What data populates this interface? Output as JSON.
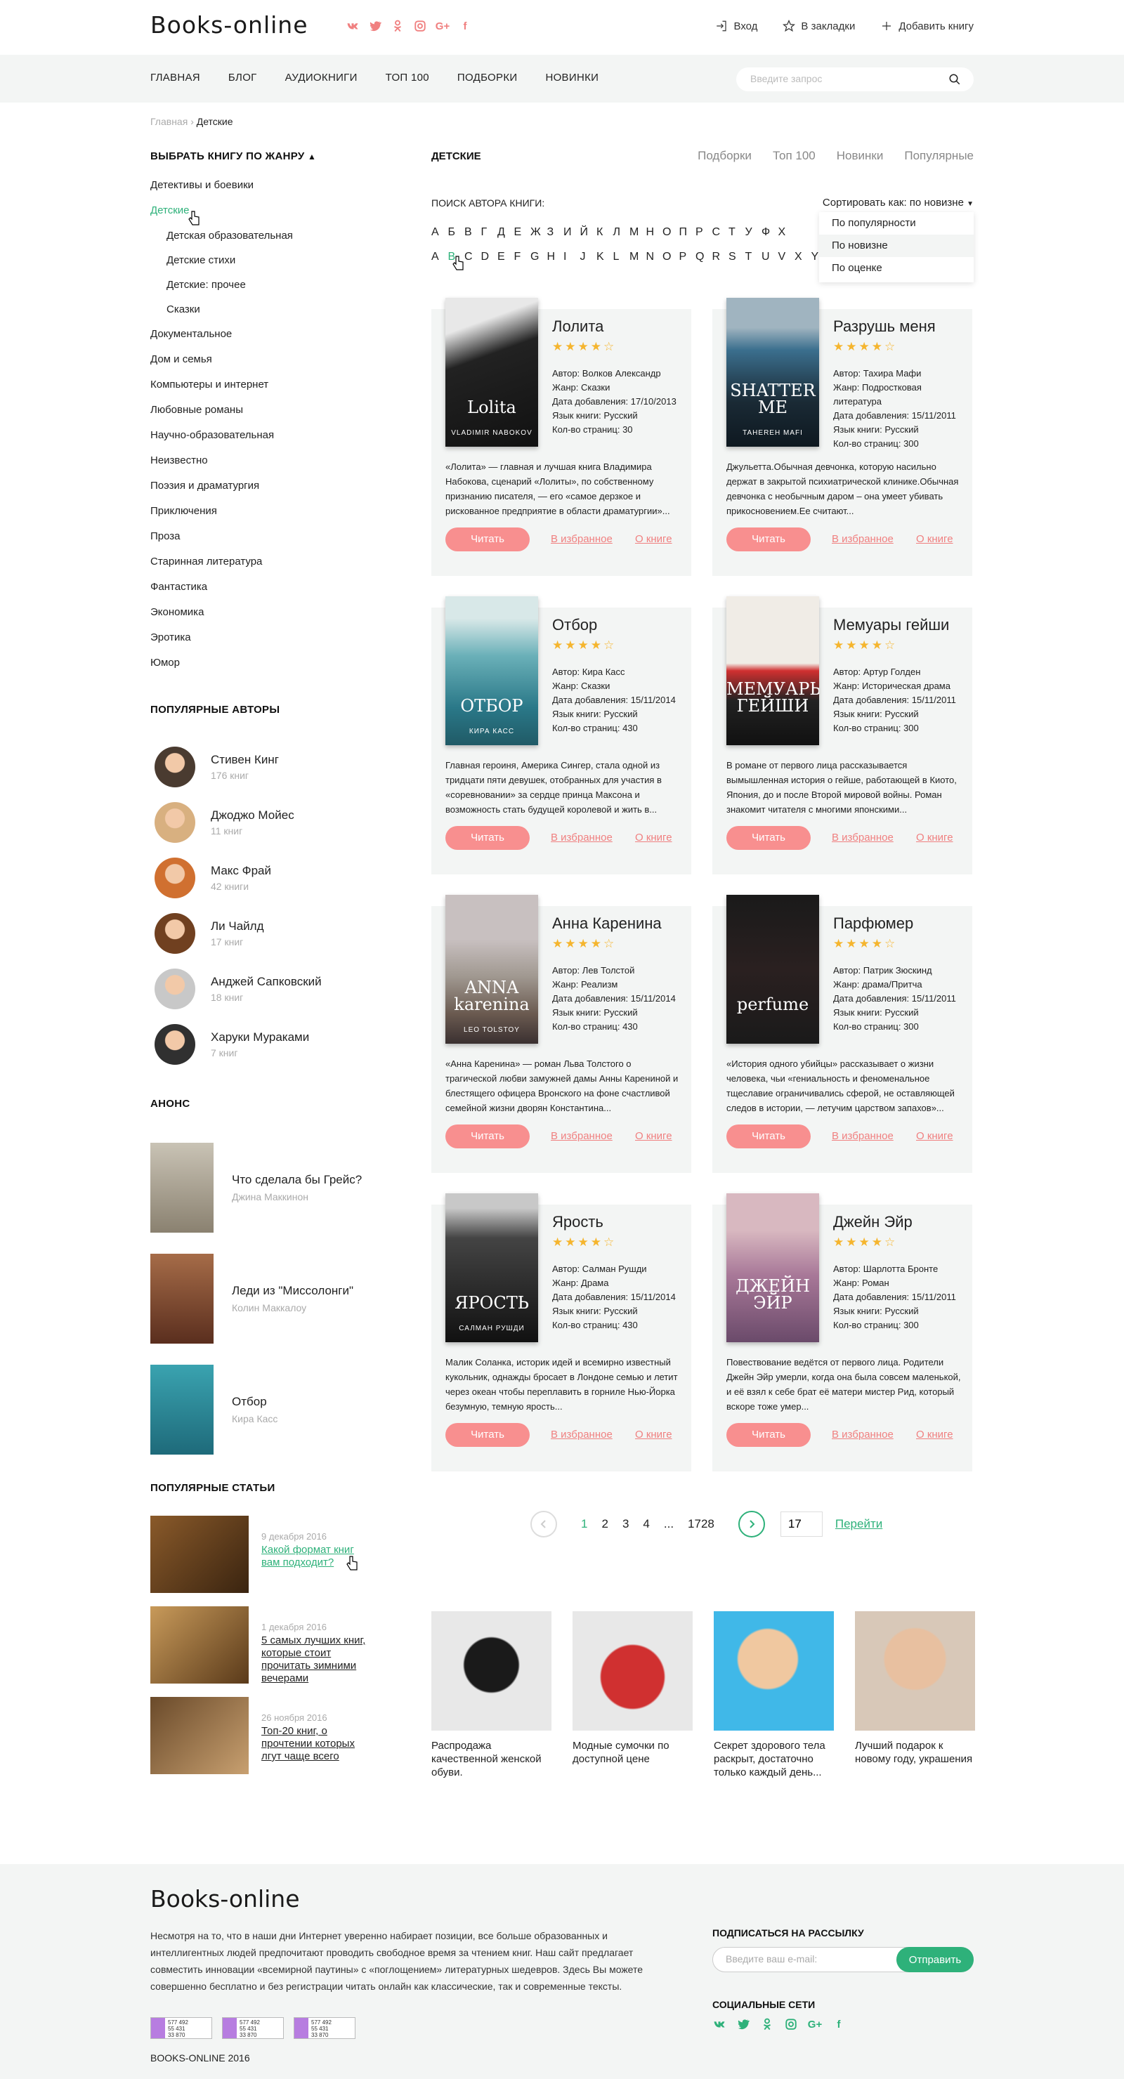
{
  "header": {
    "logo": "Books-online",
    "social_icons": [
      "vk-icon",
      "twitter-icon",
      "odnoklassniki-icon",
      "instagram-icon",
      "google-plus-icon",
      "facebook-icon"
    ],
    "login": "Вход",
    "bookmarks": "В закладки",
    "add_book": "Добавить книгу"
  },
  "nav": {
    "items": [
      "ГЛАВНАЯ",
      "БЛОГ",
      "АУДИОКНИГИ",
      "ТОП 100",
      "ПОДБОРКИ",
      "НОВИНКИ"
    ],
    "search_placeholder": "Введите запрос"
  },
  "breadcrumb": {
    "home": "Главная",
    "sep": "›",
    "current": "Детские"
  },
  "sidebar": {
    "genre_title": "ВЫБРАТЬ КНИГУ ПО ЖАНРУ",
    "genres_before": [
      "Детективы и боевики"
    ],
    "active_genre": "Детские",
    "subgenres": [
      "Детская образовательная",
      "Детские стихи",
      "Детские: прочее",
      "Сказки"
    ],
    "genres_after": [
      "Документальное",
      "Дом и семья",
      "Компьютеры и интернет",
      "Любовные романы",
      "Научно-образовательная",
      "Неизвестно",
      "Поэзия и драматургия",
      "Приключения",
      "Проза",
      "Старинная литература",
      "Фантастика",
      "Экономика",
      "Эротика",
      "Юмор"
    ],
    "authors_title": "ПОПУЛЯРНЫЕ АВТОРЫ",
    "authors": [
      {
        "name": "Стивен Кинг",
        "count": "176 книг"
      },
      {
        "name": "Джоджо Мойес",
        "count": "11 книг"
      },
      {
        "name": "Макс Фрай",
        "count": "42 книги"
      },
      {
        "name": "Ли Чайлд",
        "count": "17 книг"
      },
      {
        "name": "Анджей Сапковский",
        "count": "18 книг"
      },
      {
        "name": "Харуки Мураками",
        "count": "7 книг"
      }
    ],
    "anons_title": "АНОНС",
    "anons": [
      {
        "title": "Что сделала бы Грейс?",
        "author": "Джина Маккинон"
      },
      {
        "title": "Леди из \"Миссолонги\"",
        "author": "Колин Маккалоу"
      },
      {
        "title": "Отбор",
        "author": "Кира Касс"
      }
    ],
    "articles_title": "ПОПУЛЯРНЫЕ СТАТЬИ",
    "articles": [
      {
        "date": "9 декабря 2016",
        "title": "Какой формат книг вам подходит?"
      },
      {
        "date": "1 декабря 2016",
        "title": "5 самых лучших книг, которые стоит прочитать зимними вечерами"
      },
      {
        "date": "26 ноября 2016",
        "title": "Топ-20 книг, о прочтении которых лгут чаще всего"
      }
    ]
  },
  "main": {
    "title": "ДЕТСКИЕ",
    "tabs": [
      "Подборки",
      "Топ 100",
      "Новинки",
      "Популярные"
    ],
    "author_search": "ПОИСК АВТОРА КНИГИ:",
    "sort_label": "Сортировать как: по новизне",
    "sort_options": [
      "По популярности",
      "По новизне",
      "По оценке"
    ],
    "alphabet_ru": [
      "А",
      "Б",
      "В",
      "Г",
      "Д",
      "Е",
      "Ж",
      "З",
      "И",
      "Й",
      "К",
      "Л",
      "М",
      "Н",
      "О",
      "П",
      "Р",
      "С",
      "Т",
      "У",
      "Ф",
      "Х"
    ],
    "alphabet_en": [
      "A",
      "B",
      "C",
      "D",
      "E",
      "F",
      "G",
      "H",
      "I",
      "J",
      "K",
      "L",
      "M",
      "N",
      "O",
      "P",
      "Q",
      "R",
      "S",
      "T",
      "U",
      "V",
      "X",
      "Y"
    ],
    "labels": {
      "author": "Автор:",
      "genre": "Жанр:",
      "date": "Дата добавления:",
      "lang": "Язык книги:",
      "pages": "Кол-во страниц:",
      "read": "Читать",
      "fav": "В избранное",
      "about": "О книге"
    },
    "books": [
      {
        "title": "Лолита",
        "rating": 4,
        "author": "Волков Александр",
        "genre": "Сказки",
        "date": "17/10/2013",
        "lang": "Русский",
        "pages": "30",
        "desc": "«Лолита» — главная и лучшая книга Владимира Набокова, сценарий «Лолиты», по собственному признанию писателя, — его «самое дерзкое и рискованное предприятие в области драматургии»...",
        "cover_text": "Lolita",
        "cover_sub": "VLADIMIR NABOKOV"
      },
      {
        "title": "Разрушь меня",
        "rating": 4,
        "author": "Тахира Мафи",
        "genre": "Подростковая литература",
        "date": "15/11/2011",
        "lang": "Русский",
        "pages": "300",
        "desc": "Джульетта.Обычная девчонка, которую насильно держат в закрытой психиатрической клинике.Обычная девчонка с необычным даром – она умеет убивать прикосновением.Ее считают...",
        "cover_text": "SHATTER ME",
        "cover_sub": "TAHEREH MAFI"
      },
      {
        "title": "Отбор",
        "rating": 4,
        "author": "Кира Касс",
        "genre": "Сказки",
        "date": "15/11/2014",
        "lang": "Русский",
        "pages": "430",
        "desc": "Главная героиня, Америка Сингер, стала одной из тридцати пяти девушек, отобранных для участия в «соревновании» за сердце принца Максона и возможность стать будущей королевой и жить в...",
        "cover_text": "ОТБОР",
        "cover_sub": "КИРА КАСС"
      },
      {
        "title": "Мемуары гейши",
        "rating": 4,
        "author": "Артур Голден",
        "genre": "Историческая драма",
        "date": "15/11/2011",
        "lang": "Русский",
        "pages": "300",
        "desc": "В романе от первого лица рассказывается вымышленная история о гейше, работающей в Киото, Япония, до и после Второй мировой войны. Роман знакомит читателя с многими японскими...",
        "cover_text": "МЕМУАРЫ ГЕЙШИ",
        "cover_sub": ""
      },
      {
        "title": "Анна Каренина",
        "rating": 4,
        "author": "Лев Толстой",
        "genre": "Реализм",
        "date": "15/11/2014",
        "lang": "Русский",
        "pages": "430",
        "desc": "«Анна Каренина» — роман Льва Толстого о трагической любви замужней дамы Анны Карениной и блестящего офицера Вронского на фоне счастливой семейной жизни дворян Константина...",
        "cover_text": "ANNA karenina",
        "cover_sub": "LEO TOLSTOY"
      },
      {
        "title": "Парфюмер",
        "rating": 4,
        "author": "Патрик Зюскинд",
        "genre": "драма/Притча",
        "date": "15/11/2011",
        "lang": "Русский",
        "pages": "300",
        "desc": "«История одного убийцы» рассказывает о жизни человека, чьи «гениальность и феноменальное тщеславие ограничивались сферой, не оставляющей следов в истории, — летучим царством запахов»...",
        "cover_text": "perfume",
        "cover_sub": ""
      },
      {
        "title": "Ярость",
        "rating": 4,
        "author": "Салман Рушди",
        "genre": "Драма",
        "date": "15/11/2014",
        "lang": "Русский",
        "pages": "430",
        "desc": "Малик Соланка, историк идей и всемирно известный кукольник, однажды бросает в Лондоне семью и летит через океан чтобы переплавить в горниле Нью-Йорка безумную, темную ярость...",
        "cover_text": "ЯРОСТЬ",
        "cover_sub": "САЛМАН РУШДИ"
      },
      {
        "title": "Джейн Эйр",
        "rating": 4,
        "author": "Шарлотта Бронте",
        "genre": "Роман",
        "date": "15/11/2011",
        "lang": "Русский",
        "pages": "300",
        "desc": "Повествование ведётся от первого лица. Родители Джейн Эйр умерли, когда она была совсем маленькой, и её взял к себе брат её матери мистер Рид, который вскоре тоже умер...",
        "cover_text": "ДЖЕЙН ЭЙР",
        "cover_sub": ""
      }
    ],
    "pager": {
      "pages": [
        "1",
        "2",
        "3",
        "4",
        "...",
        "1728"
      ],
      "input": "17",
      "go": "Перейти"
    },
    "promos": [
      {
        "text": "Распродажа качественной женской обуви."
      },
      {
        "text": "Модные сумочки по доступной цене"
      },
      {
        "text": "Секрет здорового тела раскрыт, достаточно только каждый день..."
      },
      {
        "text": "Лучший подарок к новому году, украшения"
      }
    ]
  },
  "footer": {
    "logo": "Books-online",
    "text": "Несмотря на то, что в наши дни Интернет уверенно набирает позиции, все больше образованных и интеллигентных людей предпочитают проводить свободное время за чтением книг. Наш сайт предлагает совместить инновации «всемирной паутины» с «поглощением» литературных шедевров. Здесь Вы можете совершенно бесплатно и без регистрации читать онлайн как классические, так и современные тексты.",
    "counters": [
      [
        "577 492",
        "55 431",
        "33 870"
      ],
      [
        "577 492",
        "55 431",
        "33 870"
      ],
      [
        "577 492",
        "55 431",
        "33 870"
      ]
    ],
    "copyright": "BOOKS-ONLINE 2016",
    "subscribe_title": "ПОДПИСАТЬСЯ НА РАССЫЛКУ",
    "email_placeholder": "Введите ваш e-mail:",
    "send": "Отправить",
    "social_title": "СОЦИАЛЬНЫЕ СЕТИ"
  }
}
